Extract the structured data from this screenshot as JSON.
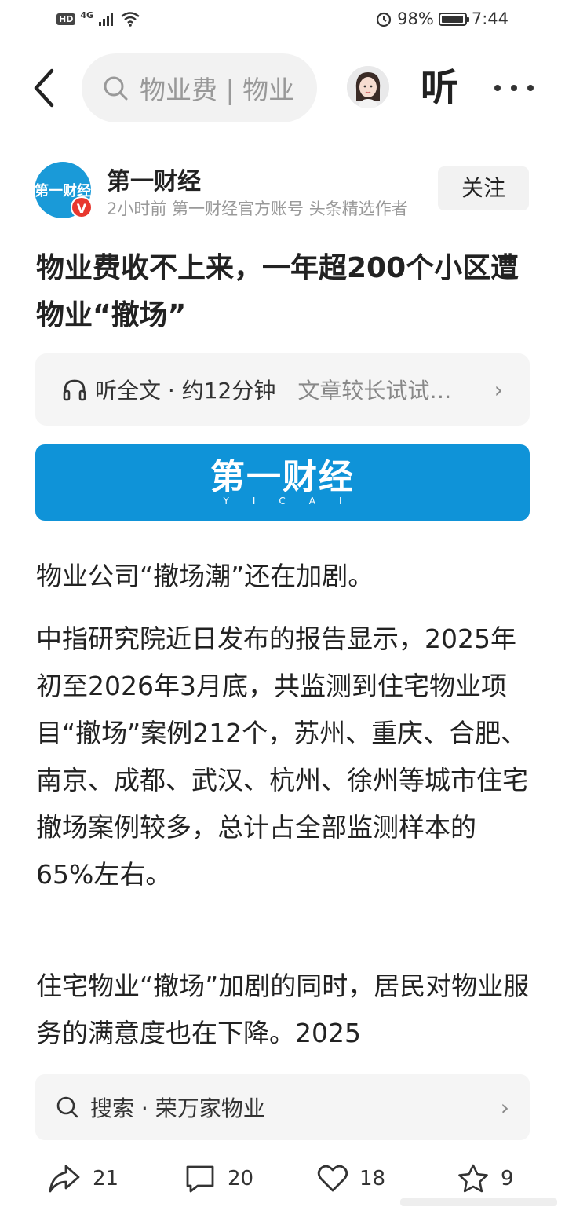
{
  "status_bar": {
    "hd": "HD",
    "network": "4G",
    "battery_percent": "98%",
    "battery_level": 0.98,
    "time": "7:44"
  },
  "nav": {
    "search_text": "物业费 | 物业",
    "listen_label": "听"
  },
  "author": {
    "logo_text": "第一财经",
    "verified_badge": "V",
    "name": "第一财经",
    "meta": "2小时前   第一财经官方账号 头条精选作者",
    "follow_label": "关注"
  },
  "article": {
    "title": "物业费收不上来，一年超200个小区遭物业“撤场”",
    "listen_bar": {
      "label": "听全文 · 约12分钟",
      "hint": "文章较长试试…"
    },
    "banner": {
      "logo": "第一财经",
      "sub": "YICAI"
    },
    "paragraphs": [
      "物业公司“撤场潮”还在加剧。",
      "中指研究院近日发布的报告显示，2025年初至2026年3月底，共监测到住宅物业项目“撤场”案例212个，苏州、重庆、合肥、南京、成都、武汉、杭州、徐州等城市住宅撤场案例较多，总计占全部监测样本的65%左右。",
      "住宅物业“撤场”加剧的同时，居民对物业服务的满意度也在下降。2025"
    ]
  },
  "related_search": {
    "text": "搜索 · 荣万家物业"
  },
  "actions": {
    "share_count": "21",
    "comment_count": "20",
    "like_count": "18",
    "favorite_count": "9"
  },
  "icons": {
    "back": "back-arrow-icon",
    "search": "search-icon",
    "headphones": "headphones-icon",
    "share": "share-icon",
    "comment": "comment-icon",
    "like": "heart-icon",
    "favorite": "star-icon"
  }
}
